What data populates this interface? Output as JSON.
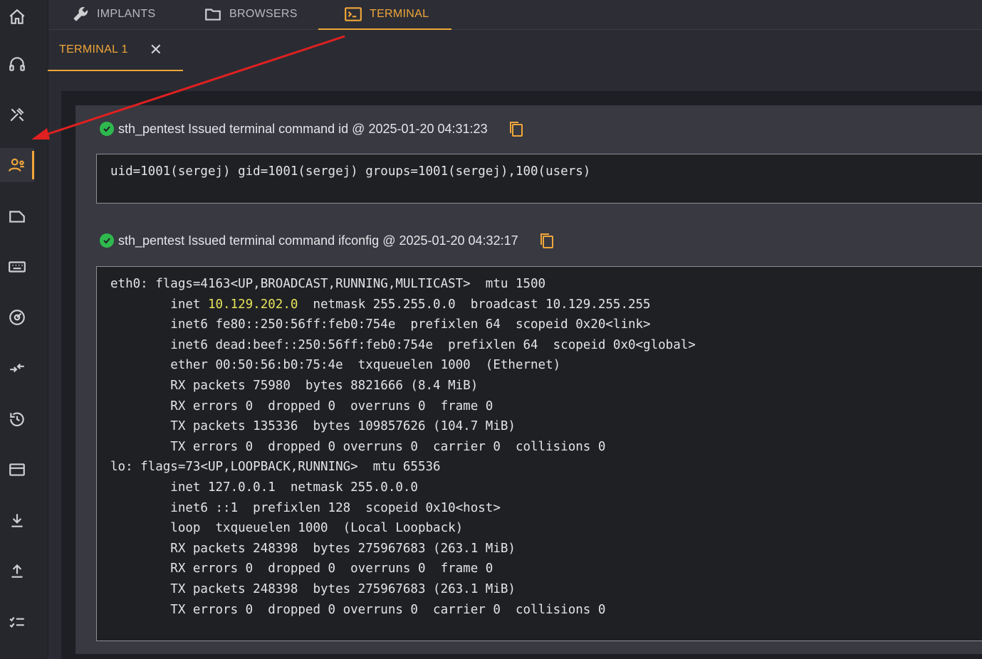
{
  "rail": {
    "icons": [
      "home-icon",
      "headset-icon",
      "tools-icon",
      "users-icon",
      "folder-icon",
      "keyboard-icon",
      "crosshair-icon",
      "swap-icon",
      "history-icon",
      "card-icon",
      "download-icon",
      "upload-icon",
      "checklist-icon"
    ],
    "active_index": 3
  },
  "toptabs": {
    "implants": "IMPLANTS",
    "browsers": "BROWSERS",
    "terminal": "TERMINAL"
  },
  "subtab": {
    "label": "TERMINAL 1",
    "close": "✕"
  },
  "commands": [
    {
      "header": "sth_pentest Issued terminal command id @ 2025-01-20 04:31:23",
      "output": "uid=1001(sergej) gid=1001(sergej) groups=1001(sergej),100(users)"
    },
    {
      "header": "sth_pentest Issued terminal command ifconfig @ 2025-01-20 04:32:17",
      "output_line1": "eth0: flags=4163<UP,BROADCAST,RUNNING,MULTICAST>  mtu 1500",
      "inet_prefix": "        inet ",
      "inet_ip": "10.129.202.0",
      "inet_suffix": "  netmask 255.255.0.0  broadcast 10.129.255.255",
      "output_rest": "        inet6 fe80::250:56ff:feb0:754e  prefixlen 64  scopeid 0x20<link>\n        inet6 dead:beef::250:56ff:feb0:754e  prefixlen 64  scopeid 0x0<global>\n        ether 00:50:56:b0:75:4e  txqueuelen 1000  (Ethernet)\n        RX packets 75980  bytes 8821666 (8.4 MiB)\n        RX errors 0  dropped 0  overruns 0  frame 0\n        TX packets 135336  bytes 109857626 (104.7 MiB)\n        TX errors 0  dropped 0 overruns 0  carrier 0  collisions 0\nlo: flags=73<UP,LOOPBACK,RUNNING>  mtu 65536\n        inet 127.0.0.1  netmask 255.0.0.0\n        inet6 ::1  prefixlen 128  scopeid 0x10<host>\n        loop  txqueuelen 1000  (Local Loopback)\n        RX packets 248398  bytes 275967683 (263.1 MiB)\n        RX errors 0  dropped 0  overruns 0  frame 0\n        TX packets 248398  bytes 275967683 (263.1 MiB)\n        TX errors 0  dropped 0 overruns 0  carrier 0  collisions 0"
    }
  ],
  "colors": {
    "accent": "#f0a63a",
    "success": "#2fb84d",
    "highlight": "#e7e35c",
    "annotation": "#e02020"
  }
}
